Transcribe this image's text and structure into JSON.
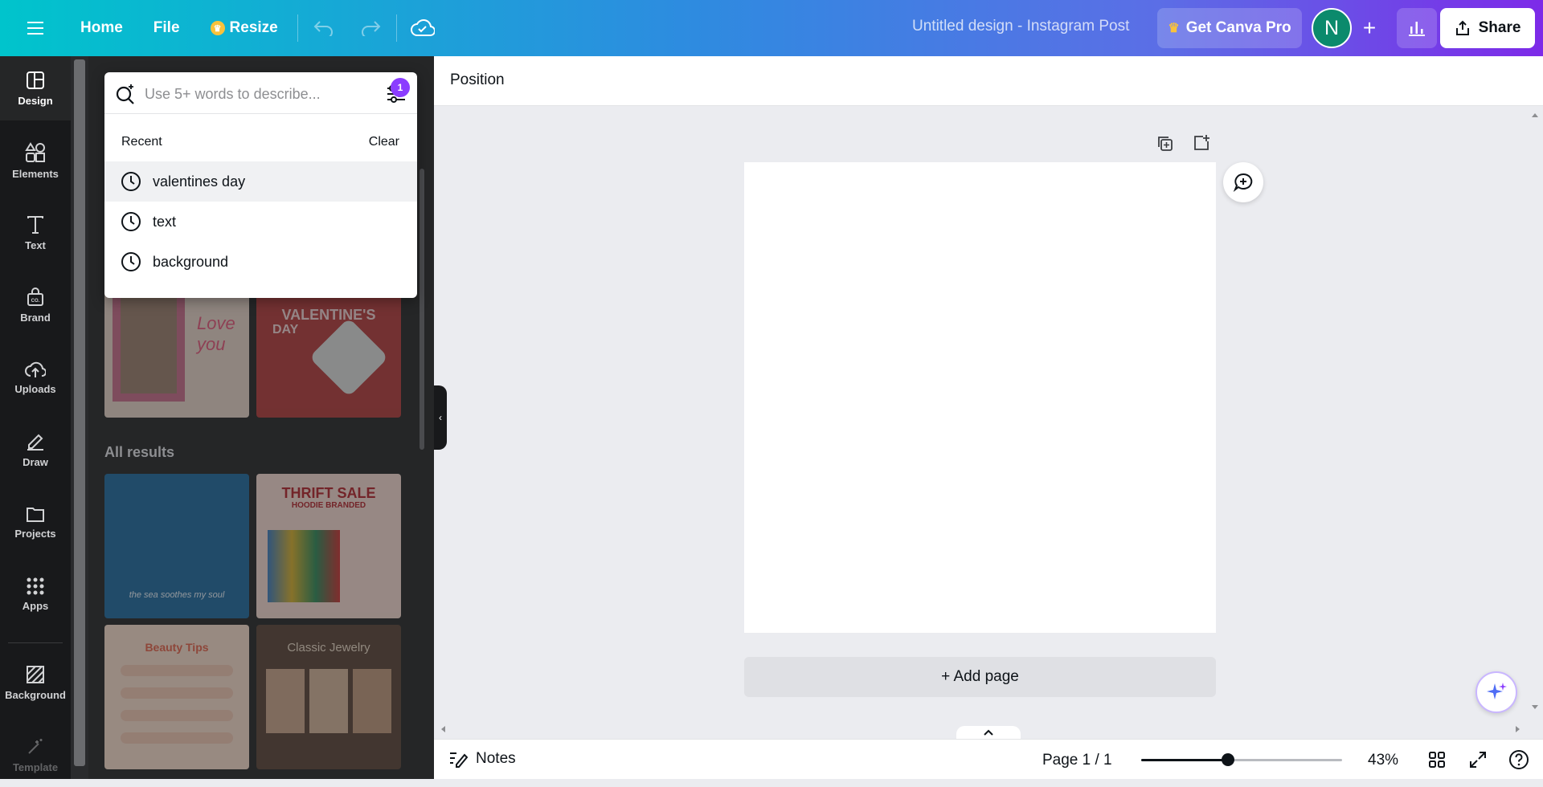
{
  "header": {
    "home_label": "Home",
    "file_label": "File",
    "resize_label": "Resize",
    "doc_title": "Untitled design - Instagram Post",
    "pro_label": "Get Canva Pro",
    "avatar_letter": "N",
    "share_label": "Share"
  },
  "rail": {
    "items": [
      {
        "label": "Design",
        "icon": "layout-icon"
      },
      {
        "label": "Elements",
        "icon": "shapes-icon"
      },
      {
        "label": "Text",
        "icon": "text-icon"
      },
      {
        "label": "Brand",
        "icon": "brand-icon"
      },
      {
        "label": "Uploads",
        "icon": "cloud-upload-icon"
      },
      {
        "label": "Draw",
        "icon": "pen-icon"
      },
      {
        "label": "Projects",
        "icon": "folder-icon"
      },
      {
        "label": "Apps",
        "icon": "apps-grid-icon"
      },
      {
        "label": "Background",
        "icon": "background-icon"
      },
      {
        "label": "Template",
        "icon": "magic-icon"
      }
    ]
  },
  "search": {
    "placeholder": "Use 5+ words to describe...",
    "filter_badge": "1",
    "recent_label": "Recent",
    "clear_label": "Clear",
    "recent_items": [
      "valentines day",
      "text",
      "background"
    ]
  },
  "panel": {
    "all_results_label": "All results",
    "templates": {
      "t2_title": "VALENTINE'S",
      "t2_sub": "DAY",
      "t3_caption": "the sea soothes my soul",
      "t4_title": "THRIFT SALE",
      "t4_sub": "HOODIE BRANDED",
      "t5_title": "Beauty Tips",
      "t6_title": "Classic Jewelry"
    }
  },
  "context": {
    "position_label": "Position"
  },
  "canvas": {
    "add_page_label": "+ Add page"
  },
  "footer": {
    "notes_label": "Notes",
    "page_label": "Page 1 / 1",
    "zoom_label": "43%",
    "zoom_value": 0.43
  },
  "colors": {
    "accent_purple": "#8b3dff",
    "avatar_green": "#0b8a6c"
  }
}
